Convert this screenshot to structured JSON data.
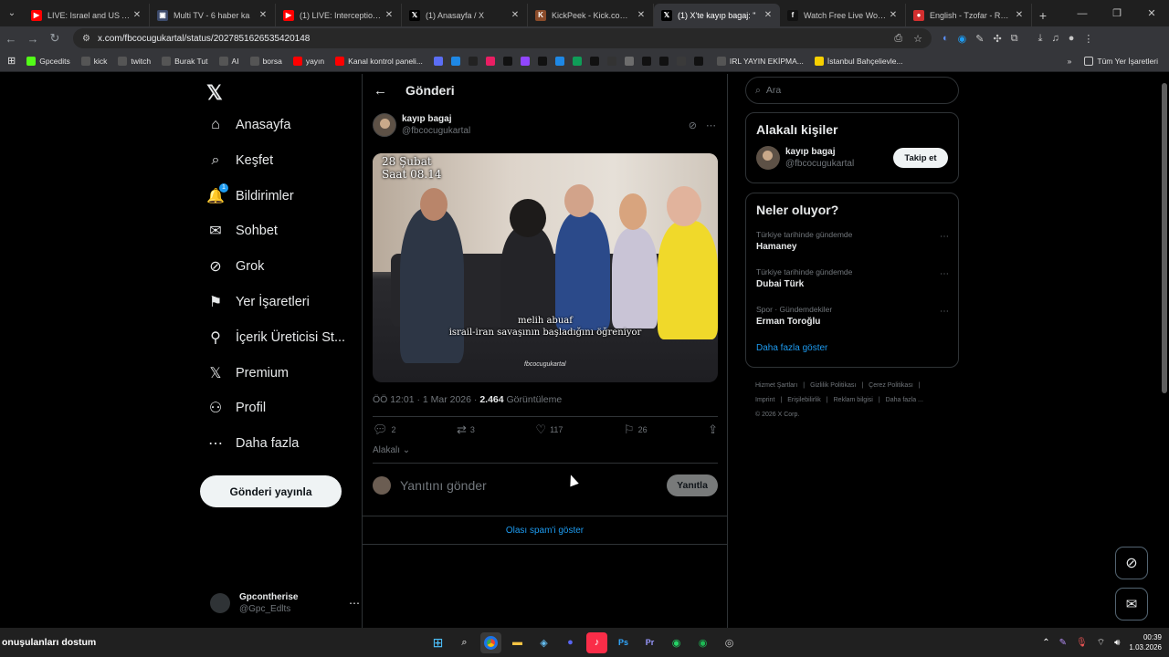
{
  "browser": {
    "tabs": [
      {
        "title": "LIVE: Israel and US Attack",
        "color": "#ff0000",
        "glyph": "▶",
        "active": false
      },
      {
        "title": "Multi TV - 6 haber ka",
        "color": "#3c4a6b",
        "glyph": "▣",
        "active": false
      },
      {
        "title": "(1) LIVE: Interceptions in",
        "color": "#ff0000",
        "glyph": "▶",
        "active": false
      },
      {
        "title": "(1) Anasayfa / X",
        "color": "#000000",
        "glyph": "𝕏",
        "active": false
      },
      {
        "title": "KickPeek - Kick.com için",
        "color": "#8a4b2a",
        "glyph": "K",
        "active": false
      },
      {
        "title": "(1) X'te kayıp bagaj: \"",
        "color": "#000000",
        "glyph": "𝕏",
        "active": true
      },
      {
        "title": "Watch Free Live World TV",
        "color": "#111111",
        "glyph": "f",
        "active": false
      },
      {
        "title": "English - Tzofar - Red Ale",
        "color": "#d32f2f",
        "glyph": "●",
        "active": false
      }
    ],
    "url": "x.com/fbcocugukartal/status/2027851626535420148",
    "bookmarks": [
      {
        "label": "Gpcedits",
        "color": "#53fc18"
      },
      {
        "label": "kick",
        "color": "#555"
      },
      {
        "label": "twitch",
        "color": "#555"
      },
      {
        "label": "Burak Tut",
        "color": "#555"
      },
      {
        "label": "AI",
        "color": "#555"
      },
      {
        "label": "borsa",
        "color": "#555"
      },
      {
        "label": "yayın",
        "color": "#ff0000"
      },
      {
        "label": "Kanal kontrol paneli...",
        "color": "#ff0000"
      }
    ],
    "bookmarks_right": [
      {
        "label": "IRL YAYIN EKİPMA...",
        "color": "#555"
      },
      {
        "label": "İstanbul Bahçelievle...",
        "color": "#f7d000"
      }
    ],
    "all_bookmarks": "Tüm Yer İşaretleri"
  },
  "nav": {
    "items": [
      {
        "label": "Anasayfa",
        "icon": "home-icon",
        "glyph": "⌂"
      },
      {
        "label": "Keşfet",
        "icon": "search-icon",
        "glyph": "⌕"
      },
      {
        "label": "Bildirimler",
        "icon": "bell-icon",
        "glyph": "🔔",
        "badge": "1"
      },
      {
        "label": "Sohbet",
        "icon": "mail-icon",
        "glyph": "✉"
      },
      {
        "label": "Grok",
        "icon": "grok-icon",
        "glyph": "⊘"
      },
      {
        "label": "Yer İşaretleri",
        "icon": "bookmark-icon",
        "glyph": "⚑"
      },
      {
        "label": "İçerik Üreticisi St...",
        "icon": "creator-icon",
        "glyph": "⚲"
      },
      {
        "label": "Premium",
        "icon": "x-premium-icon",
        "glyph": "𝕏"
      },
      {
        "label": "Profil",
        "icon": "profile-icon",
        "glyph": "⚇"
      },
      {
        "label": "Daha fazla",
        "icon": "more-circle-icon",
        "glyph": "⋯"
      }
    ],
    "post_button": "Gönderi yayınla",
    "account": {
      "name": "Gpcontherise",
      "handle": "@Gpc_Edlts"
    }
  },
  "post": {
    "header_title": "Gönderi",
    "author_name": "kayıp bagaj",
    "author_handle": "@fbcocugukartal",
    "overlay_top_line1": "28 Şubat",
    "overlay_top_line2": "Saat 08.14",
    "caption_line1": "melih abuaf",
    "caption_line2": "israil-iran savaşının başladığını öğreniyor",
    "watermark": "fbcocugukartal",
    "timestamp": "ÖÖ 12:01 · 1 Mar 2026 · ",
    "views": "2.464",
    "views_label": "Görüntüleme",
    "replies": "2",
    "reposts": "3",
    "likes": "117",
    "bookmarks": "26",
    "related": "Alakalı",
    "reply_placeholder": "Yanıtını gönder",
    "reply_button": "Yanıtla",
    "spam_link": "Olası spam'i göster"
  },
  "right": {
    "search_placeholder": "Ara",
    "related_title": "Alakalı kişiler",
    "related_person": {
      "name": "kayıp bagaj",
      "handle": "@fbcocugukartal",
      "follow": "Takip et"
    },
    "trends_title": "Neler oluyor?",
    "trends": [
      {
        "context": "Türkiye tarihinde gündemde",
        "topic": "Hamaney"
      },
      {
        "context": "Türkiye tarihinde gündemde",
        "topic": "Dubai Türk"
      },
      {
        "context": "Spor · Gündemdekiler",
        "topic": "Erman Toroğlu"
      }
    ],
    "show_more": "Daha fazla göster",
    "footer_links": [
      "Hizmet Şartları",
      "|",
      "Gizlilik Politikası",
      "|",
      "Çerez Politikası",
      "|",
      "Imprint",
      "|",
      "Erişilebilirlik",
      "|",
      "Reklam bilgisi",
      "|",
      "Daha fazla ...",
      "© 2026 X Corp."
    ]
  },
  "taskbar": {
    "left_text": "onuşulanları dostum",
    "time": "00:39",
    "date": "1.03.2026"
  }
}
